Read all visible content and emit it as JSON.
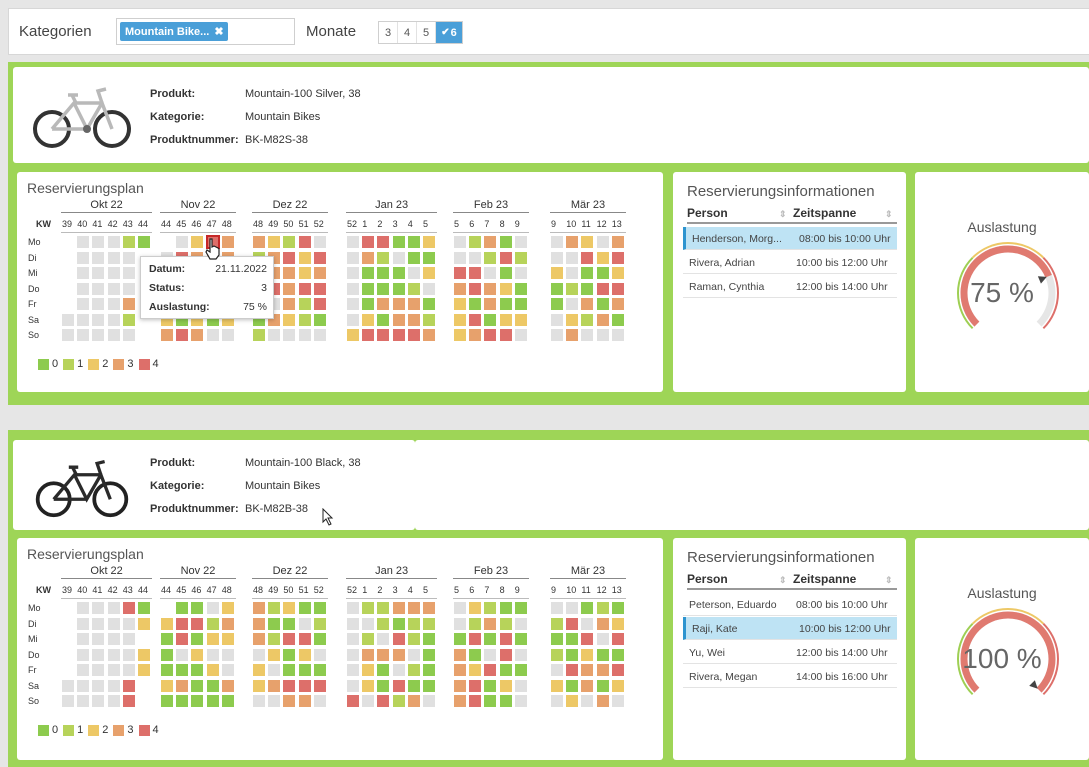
{
  "filter": {
    "kategorien_label": "Kategorien",
    "tag_label": "Mountain Bike...",
    "tag_remove": "✖",
    "monate_label": "Monate",
    "months_options": [
      "3",
      "4",
      "5",
      "6"
    ],
    "months_selected": "6",
    "check": "✔"
  },
  "plan_labels": {
    "title": "Reservierungsplan",
    "months": [
      "Okt 22",
      "Nov 22",
      "Dez 22",
      "Jan 23",
      "Feb 23",
      "Mär 23"
    ],
    "kw_label": "KW",
    "weeks": [
      [
        "39",
        "40",
        "41",
        "42",
        "43",
        "44"
      ],
      [
        "44",
        "45",
        "46",
        "47",
        "48"
      ],
      [
        "48",
        "49",
        "50",
        "51",
        "52"
      ],
      [
        "52",
        "1",
        "2",
        "3",
        "4",
        "5"
      ],
      [
        "5",
        "6",
        "7",
        "8",
        "9"
      ],
      [
        "9",
        "10",
        "11",
        "12",
        "13"
      ]
    ],
    "days": [
      "Mo",
      "Di",
      "Mi",
      "Do",
      "Fr",
      "Sa",
      "So"
    ],
    "legend": [
      "0",
      "1",
      "2",
      "3",
      "4"
    ]
  },
  "colors": {
    "level": [
      "#8dcb4e",
      "#b7d35a",
      "#edc866",
      "#e7a16c",
      "#dd6f6a"
    ],
    "empty": "#e0e0e0",
    "accent": "#4a9fd8",
    "section_bg": "#9ed557"
  },
  "res_labels": {
    "title": "Reservierungsinformationen",
    "col_person": "Person",
    "col_zeit": "Zeitspanne",
    "sort_icon": "⇕"
  },
  "gauge_label": "Auslastung",
  "products": [
    {
      "produkt_label": "Produkt:",
      "produkt": "Mountain-100 Silver, 38",
      "kategorie_label": "Kategorie:",
      "kategorie": "Mountain Bikes",
      "nummer_label": "Produktnummer:",
      "nummer": "BK-M82S-38",
      "bike_color": "silver",
      "reservations": [
        {
          "person": "Henderson, Morg...",
          "zeit": "08:00 bis 10:00 Uhr",
          "selected": true
        },
        {
          "person": "Rivera, Adrian",
          "zeit": "10:00 bis 12:00 Uhr",
          "selected": false
        },
        {
          "person": "Raman, Cynthia",
          "zeit": "12:00 bis 14:00 Uhr",
          "selected": false
        }
      ],
      "utilization_pct": 75,
      "utilization_label": "75 %",
      "tooltip": {
        "datum_label": "Datum:",
        "datum": "21.11.2022",
        "status_label": "Status:",
        "status": "3",
        "ausl_label": "Auslastung:",
        "ausl": "75 %"
      }
    },
    {
      "produkt_label": "Produkt:",
      "produkt": "Mountain-100 Black, 38",
      "kategorie_label": "Kategorie:",
      "kategorie": "Mountain Bikes",
      "nummer_label": "Produktnummer:",
      "nummer": "BK-M82B-38",
      "bike_color": "black",
      "reservations": [
        {
          "person": "Peterson, Eduardo",
          "zeit": "08:00 bis 10:00 Uhr",
          "selected": false
        },
        {
          "person": "Raji, Kate",
          "zeit": "10:00 bis 12:00 Uhr",
          "selected": true
        },
        {
          "person": "Yu, Wei",
          "zeit": "12:00 bis 14:00 Uhr",
          "selected": false
        },
        {
          "person": "Rivera, Megan",
          "zeit": "14:00 bis 16:00 Uhr",
          "selected": false
        }
      ],
      "utilization_pct": 100,
      "utilization_label": "100 %"
    }
  ]
}
